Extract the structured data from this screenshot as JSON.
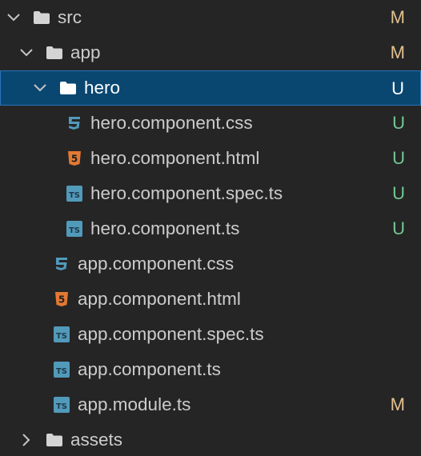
{
  "colors": {
    "modified": "#e2c08d",
    "untracked": "#73c991",
    "selected_bg": "#094771",
    "css_icon": "#519aba",
    "html_icon": "#e37933",
    "ts_icon": "#519aba"
  },
  "tree": [
    {
      "label": "src",
      "kind": "folder",
      "expanded": true,
      "depth": 0,
      "status": "M",
      "status_type": "modified",
      "icon": "folder-icon",
      "chevron": "chevron-down-icon"
    },
    {
      "label": "app",
      "kind": "folder",
      "expanded": true,
      "depth": 1,
      "status": "M",
      "status_type": "modified",
      "icon": "folder-icon",
      "chevron": "chevron-down-icon"
    },
    {
      "label": "hero",
      "kind": "folder",
      "expanded": true,
      "depth": 2,
      "status": "U",
      "status_type": "untracked",
      "selected": true,
      "icon": "folder-icon",
      "chevron": "chevron-down-icon"
    },
    {
      "label": "hero.component.css",
      "kind": "file",
      "depth": 3,
      "status": "U",
      "status_type": "untracked",
      "icon": "css-file-icon"
    },
    {
      "label": "hero.component.html",
      "kind": "file",
      "depth": 3,
      "status": "U",
      "status_type": "untracked",
      "icon": "html-file-icon"
    },
    {
      "label": "hero.component.spec.ts",
      "kind": "file",
      "depth": 3,
      "status": "U",
      "status_type": "untracked",
      "icon": "ts-file-icon",
      "badge": "TS"
    },
    {
      "label": "hero.component.ts",
      "kind": "file",
      "depth": 3,
      "status": "U",
      "status_type": "untracked",
      "icon": "ts-file-icon",
      "badge": "TS"
    },
    {
      "label": "app.component.css",
      "kind": "file",
      "depth": 2,
      "status": "",
      "icon": "css-file-icon"
    },
    {
      "label": "app.component.html",
      "kind": "file",
      "depth": 2,
      "status": "",
      "icon": "html-file-icon"
    },
    {
      "label": "app.component.spec.ts",
      "kind": "file",
      "depth": 2,
      "status": "",
      "icon": "ts-file-icon",
      "badge": "TS"
    },
    {
      "label": "app.component.ts",
      "kind": "file",
      "depth": 2,
      "status": "",
      "icon": "ts-file-icon",
      "badge": "TS"
    },
    {
      "label": "app.module.ts",
      "kind": "file",
      "depth": 2,
      "status": "M",
      "status_type": "modified",
      "icon": "ts-file-icon",
      "badge": "TS"
    },
    {
      "label": "assets",
      "kind": "folder",
      "expanded": false,
      "depth": 1,
      "status": "",
      "icon": "folder-icon",
      "chevron": "chevron-right-icon"
    }
  ]
}
